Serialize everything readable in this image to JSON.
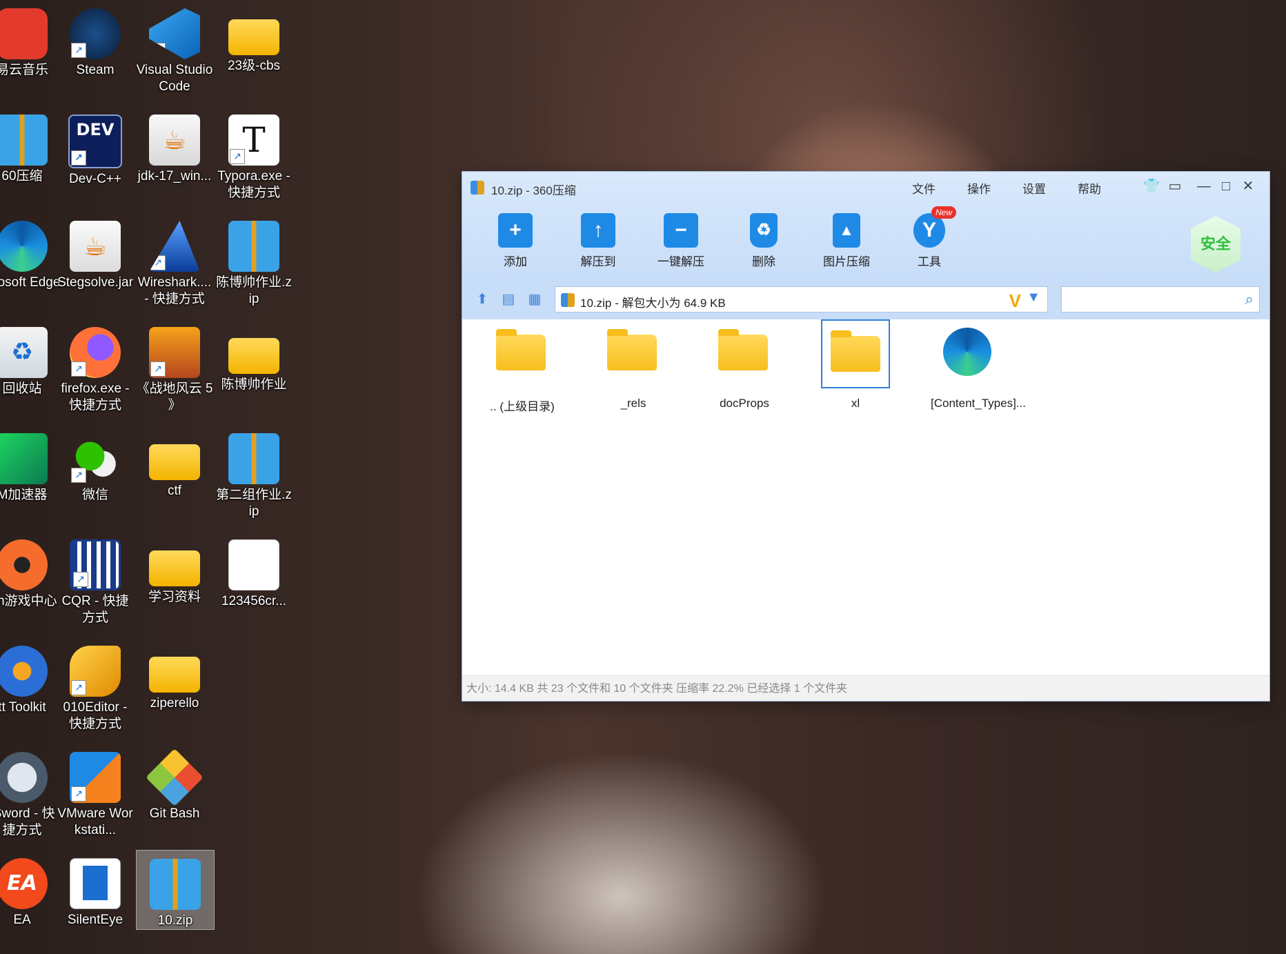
{
  "desktop": {
    "icons": [
      {
        "label": "易云音乐",
        "icon": "netease-music-icon"
      },
      {
        "label": "Steam",
        "icon": "steam-icon"
      },
      {
        "label": "Visual Studio Code",
        "icon": "vscode-icon"
      },
      {
        "label": "23级-cbs",
        "icon": "folder-icon"
      },
      {
        "label": "60压缩",
        "icon": "360zip-icon"
      },
      {
        "label": "Dev-C++",
        "icon": "devcpp-icon"
      },
      {
        "label": "jdk-17_win...",
        "icon": "java-installer-icon"
      },
      {
        "label": "Typora.exe - 快捷方式",
        "icon": "typora-icon"
      },
      {
        "label": "icrosoft Edge",
        "icon": "edge-icon"
      },
      {
        "label": "Stegsolve.jar",
        "icon": "java-jar-icon"
      },
      {
        "label": "Wireshark.... - 快捷方式",
        "icon": "wireshark-icon"
      },
      {
        "label": "陈博帅作业.zip",
        "icon": "zip-archive-icon"
      },
      {
        "label": "回收站",
        "icon": "recycle-bin-icon"
      },
      {
        "label": "firefox.exe - 快捷方式",
        "icon": "firefox-icon"
      },
      {
        "label": "《战地风云 5 》",
        "icon": "battlefield-icon"
      },
      {
        "label": "陈博帅作业",
        "icon": "folder-icon"
      },
      {
        "label": "M加速器",
        "icon": "accelerator-icon"
      },
      {
        "label": "微信",
        "icon": "wechat-icon"
      },
      {
        "label": "ctf",
        "icon": "folder-icon"
      },
      {
        "label": "第二组作业.zip",
        "icon": "zip-archive-icon"
      },
      {
        "label": "gin游戏中心",
        "icon": "origin-icon"
      },
      {
        "label": "CQR - 快捷方式",
        "icon": "qr-code-icon"
      },
      {
        "label": "学习资料",
        "icon": "folder-icon"
      },
      {
        "label": "123456cr...",
        "icon": "image-file-icon"
      },
      {
        "label": "tt Toolkit",
        "icon": "toolkit-icon"
      },
      {
        "label": "010Editor - 快捷方式",
        "icon": "010editor-icon"
      },
      {
        "label": "ziperello",
        "icon": "folder-icon"
      },
      {
        "label": "tSword - 快捷方式",
        "icon": "antsword-icon"
      },
      {
        "label": "VMware Workstati...",
        "icon": "vmware-icon"
      },
      {
        "label": "Git Bash",
        "icon": "git-bash-icon"
      },
      {
        "label": "EA",
        "icon": "ea-icon"
      },
      {
        "label": "SilentEye",
        "icon": "silenteye-icon"
      },
      {
        "label": "10.zip",
        "icon": "zip-archive-icon"
      }
    ]
  },
  "window": {
    "title": "10.zip - 360压缩",
    "menu": [
      "文件",
      "操作",
      "设置",
      "帮助"
    ],
    "toolbar": [
      {
        "label": "添加",
        "icon": "add-icon",
        "color": "#1f8ae6"
      },
      {
        "label": "解压到",
        "icon": "extract-to-icon",
        "color": "#1f8ae6"
      },
      {
        "label": "一键解压",
        "icon": "one-click-extract-icon",
        "color": "#1f8ae6"
      },
      {
        "label": "删除",
        "icon": "delete-icon",
        "color": "#1f8ae6"
      },
      {
        "label": "图片压缩",
        "icon": "image-compress-icon",
        "color": "#1f8ae6"
      },
      {
        "label": "工具",
        "icon": "tools-icon",
        "color": "#1f8ae6"
      }
    ],
    "new_badge": "New",
    "safe_badge": "安全",
    "path_text": "10.zip - 解包大小为 64.9 KB",
    "search_placeholder": "",
    "files": [
      {
        "label": ".. (上级目录)",
        "type": "folder",
        "selected": false
      },
      {
        "label": "_rels",
        "type": "folder",
        "selected": false
      },
      {
        "label": "docProps",
        "type": "folder",
        "selected": false
      },
      {
        "label": "xl",
        "type": "folder",
        "selected": true
      },
      {
        "label": "[Content_Types]...",
        "type": "edge-file",
        "selected": false
      }
    ],
    "status": "大小: 14.4 KB 共 23 个文件和 10 个文件夹 压缩率 22.2% 已经选择 1 个文件夹"
  }
}
